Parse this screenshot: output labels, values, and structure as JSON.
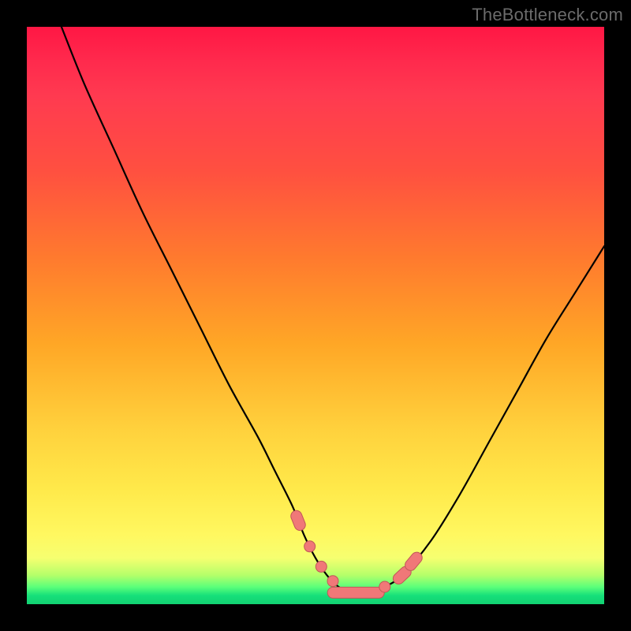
{
  "watermark": "TheBottleneck.com",
  "colors": {
    "frame": "#000000",
    "gradient_top": "#ff1744",
    "gradient_mid": "#ffd23d",
    "gradient_bottom": "#12d172",
    "curve": "#000000",
    "marker_fill": "#f07878",
    "marker_stroke": "#c05858"
  },
  "chart_data": {
    "type": "line",
    "title": "",
    "xlabel": "",
    "ylabel": "",
    "xlim": [
      0,
      100
    ],
    "ylim": [
      0,
      100
    ],
    "grid": false,
    "legend": false,
    "series": [
      {
        "name": "bottleneck-curve",
        "x": [
          6,
          10,
          15,
          20,
          25,
          30,
          35,
          40,
          43,
          46,
          48,
          50,
          52,
          54,
          56,
          58,
          60,
          62,
          65,
          70,
          75,
          80,
          85,
          90,
          95,
          100
        ],
        "y": [
          100,
          90,
          79,
          68,
          58,
          48,
          38,
          29,
          23,
          17,
          12,
          8,
          5,
          3,
          2,
          2,
          2,
          3,
          5,
          11,
          19,
          28,
          37,
          46,
          54,
          62
        ]
      }
    ],
    "markers": [
      {
        "x": 47,
        "y": 14,
        "kind": "pill"
      },
      {
        "x": 49,
        "y": 9,
        "kind": "dot"
      },
      {
        "x": 51,
        "y": 6,
        "kind": "dot"
      },
      {
        "x": 53,
        "y": 4,
        "kind": "dot"
      },
      {
        "x": 57,
        "y": 2,
        "kind": "bar"
      },
      {
        "x": 62,
        "y": 3,
        "kind": "dot"
      },
      {
        "x": 65,
        "y": 7,
        "kind": "pill"
      },
      {
        "x": 67,
        "y": 11,
        "kind": "pill"
      }
    ]
  }
}
